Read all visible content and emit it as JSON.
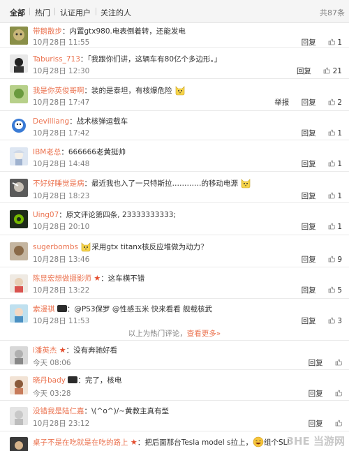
{
  "tabs": {
    "all": "全部",
    "hot": "热门",
    "verified": "认证用户",
    "following": "关注的人",
    "total": "共87条"
  },
  "labels": {
    "reply": "回复",
    "report": "举报"
  },
  "comments": [
    {
      "user": "带鹅散步",
      "text": "：内置gtx980.电表倒着转，还能发电",
      "time": "10月28日 11:55",
      "likes": "1"
    },
    {
      "user": "Taburiss_713",
      "text": "：「我跟你们讲，这辆车有80亿个多边形。」",
      "time": "10月28日 12:30",
      "likes": "21"
    },
    {
      "user": "我是你英俊哥啊",
      "text": "：装的是泰坦，有核爆危险",
      "time": "10月28日 17:47",
      "likes": "2"
    },
    {
      "user": "Devilliang",
      "text": "：战术核弹运载车",
      "time": "10月28日 17:42",
      "likes": "1"
    },
    {
      "user": "IBM老总",
      "text": "：666666老黄挺帅",
      "time": "10月28日 14:48",
      "likes": "1"
    },
    {
      "user": "不好好睡觉是病",
      "text": "：最近我也入了一只特斯拉…………的移动电源",
      "time": "10月28日 18:23",
      "likes": "1"
    },
    {
      "user": "Uing07",
      "text": "：原文评论第四条, 23333333333;",
      "time": "10月28日 20:10",
      "likes": "1"
    },
    {
      "user": "sugerbombs",
      "text": "采用gtx titanx核反应堆做为动力？",
      "time": "10月28日 13:46",
      "likes": "9"
    },
    {
      "user": "陈显宏想做摄影师",
      "text": "：这车横不错",
      "time": "10月28日 13:22",
      "likes": "5"
    },
    {
      "user": "索漫祺",
      "text": "：@PS3保罗 @性感玉米 快来看看 舰载核武",
      "time": "10月28日 11:53",
      "likes": "3"
    },
    {
      "user": "i潘英杰",
      "text": "：没有奔驰好看",
      "time": "今天 08:06",
      "likes": ""
    },
    {
      "user": "晓丹bady",
      "text": "：完了，核电",
      "time": "今天 03:28",
      "likes": ""
    },
    {
      "user": "没错我是陆仁嘉",
      "text": "：\\(^o^)/~黄教主真有型",
      "time": "10月28日 23:12",
      "likes": ""
    },
    {
      "user": "桌子不是在吃就是在吃的路上",
      "text": "：把后面那台Tesla model s拉上，",
      "text2": "组个SLI",
      "time": "",
      "likes": ""
    }
  ],
  "hot_bar": {
    "text": "以上为热门评论，",
    "link": "查看更多»"
  },
  "watermark": "3HE 当游网",
  "colors": {
    "username": "#eb7350",
    "tab_bg": "#f5f5f5",
    "divider": "#eaeaea",
    "muted": "#808080"
  }
}
